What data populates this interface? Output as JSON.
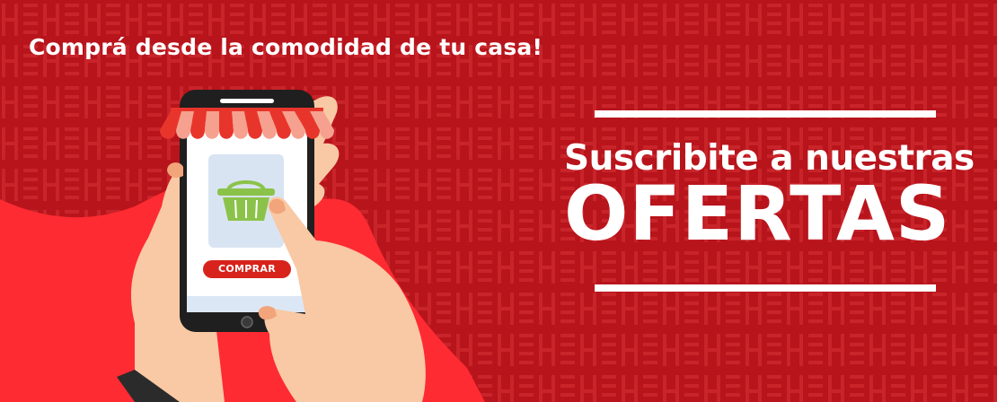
{
  "tagline": "Comprá desde la comodidad de tu casa!",
  "headline": "Suscribite a nuestras",
  "headline_big": "OFERTAS",
  "phone_button": "COMPRAR",
  "colors": {
    "background": "#b8141c",
    "wave": "#ff2b32",
    "text": "#ffffff",
    "awning_red": "#e8352b",
    "awning_light": "#f6a08f",
    "basket": "#8bc34a",
    "skin": "#f8c9a4"
  },
  "icons": [
    "shopping-basket-icon",
    "store-awning-icon",
    "home-button-icon"
  ]
}
